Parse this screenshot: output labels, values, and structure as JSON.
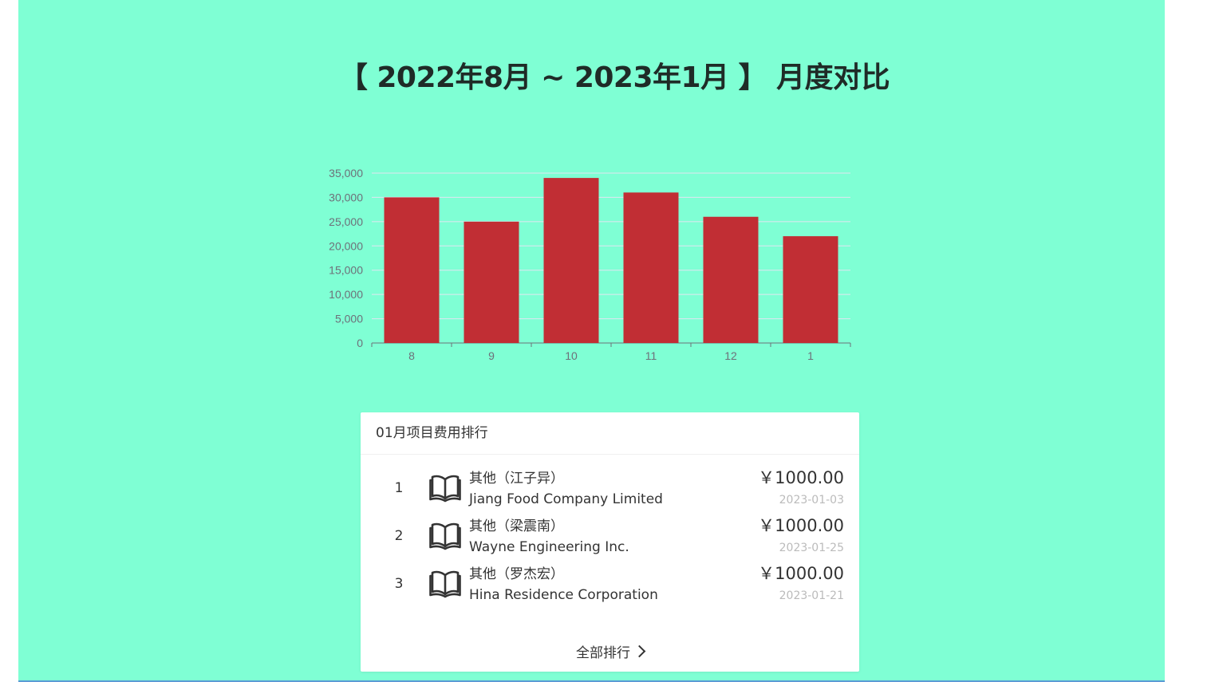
{
  "page": {
    "title": "【 2022年8月 ~ 2023年1月 】 月度对比"
  },
  "colors": {
    "background": "#7fffd4",
    "bar": "#c12e34",
    "card": "#ffffff"
  },
  "chart_data": {
    "type": "bar",
    "categories": [
      "8",
      "9",
      "10",
      "11",
      "12",
      "1"
    ],
    "values": [
      30000,
      25000,
      34000,
      31000,
      26000,
      22000
    ],
    "y_ticks": [
      "0",
      "5,000",
      "10,000",
      "15,000",
      "20,000",
      "25,000",
      "30,000",
      "35,000"
    ],
    "ylim": [
      0,
      35000
    ],
    "grid": true,
    "title": "",
    "xlabel": "",
    "ylabel": ""
  },
  "ranking": {
    "header": "01月项目费用排行",
    "items": [
      {
        "rank": "1",
        "name": "其他（江子异）",
        "company": "Jiang Food Company Limited",
        "amount": "￥1000.00",
        "date": "2023-01-03",
        "icon": "book-icon"
      },
      {
        "rank": "2",
        "name": "其他（梁震南）",
        "company": "Wayne Engineering Inc.",
        "amount": "￥1000.00",
        "date": "2023-01-25",
        "icon": "book-icon"
      },
      {
        "rank": "3",
        "name": "其他（罗杰宏）",
        "company": "Hina Residence Corporation",
        "amount": "￥1000.00",
        "date": "2023-01-21",
        "icon": "book-icon"
      }
    ],
    "more_label": "全部排行",
    "more_icon": "chevron-right-icon"
  }
}
